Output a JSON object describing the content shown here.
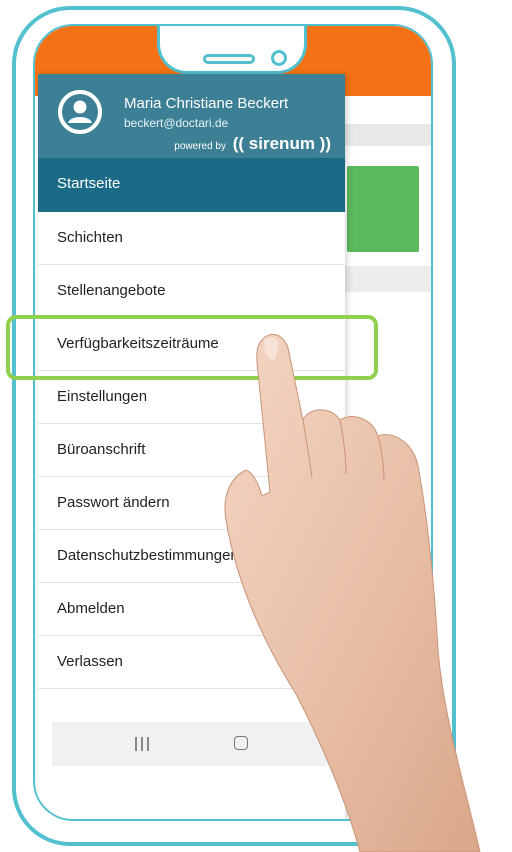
{
  "user": {
    "name": "Maria Christiane Beckert",
    "email": "beckert@doctari.de"
  },
  "branding": {
    "powered_by": "powered by",
    "brand_name": "(( sirenum ))"
  },
  "menu": {
    "items": [
      {
        "label": "Startseite",
        "active": true
      },
      {
        "label": "Schichten",
        "active": false
      },
      {
        "label": "Stellenangebote",
        "active": false
      },
      {
        "label": "Verfügbarkeitszeiträume",
        "active": false,
        "highlighted": true
      },
      {
        "label": "Einstellungen",
        "active": false
      },
      {
        "label": "Büroanschrift",
        "active": false
      },
      {
        "label": "Passwort ändern",
        "active": false
      },
      {
        "label": "Datenschutzbestimmungen",
        "active": false
      },
      {
        "label": "Abmelden",
        "active": false
      },
      {
        "label": "Verlassen",
        "active": false
      }
    ]
  },
  "nav_icons": [
    "recent-apps-icon",
    "home-icon",
    "back-icon"
  ],
  "colors": {
    "frame": "#52c0cf",
    "app_bar": "#f47215",
    "drawer_header": "#3d7f94",
    "active_item": "#1b6b87",
    "highlight": "#8fd14f",
    "background_card": "#5cb85c"
  }
}
